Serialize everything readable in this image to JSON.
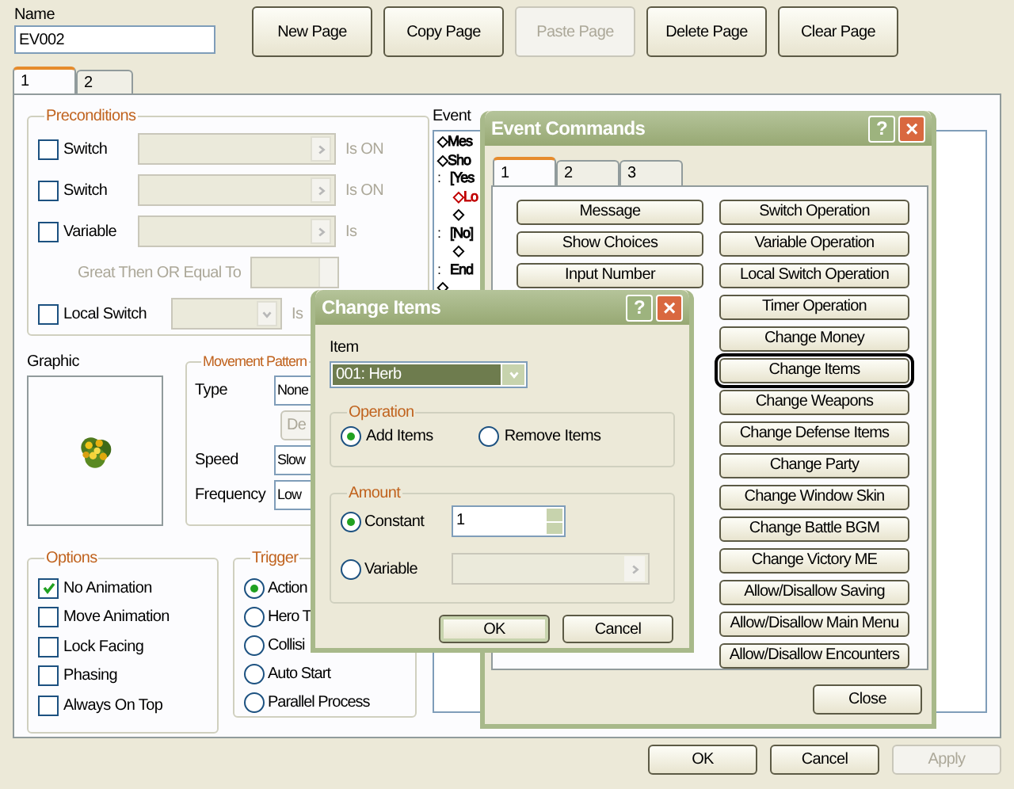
{
  "event_editor": {
    "name_label": "Name",
    "name_value": "EV002",
    "page_buttons": [
      {
        "label": "New Page",
        "disabled": false
      },
      {
        "label": "Copy Page",
        "disabled": false
      },
      {
        "label": "Paste Page",
        "disabled": true
      },
      {
        "label": "Delete Page",
        "disabled": false
      },
      {
        "label": "Clear Page",
        "disabled": false
      }
    ],
    "tabs": [
      {
        "label": "1",
        "selected": true
      },
      {
        "label": "2",
        "selected": false
      }
    ],
    "preconditions": {
      "title": "Preconditions",
      "rows": [
        {
          "kind": "select",
          "label": "Switch",
          "checked": false,
          "suffix": "Is ON"
        },
        {
          "kind": "select",
          "label": "Switch",
          "checked": false,
          "suffix": "Is ON"
        },
        {
          "kind": "select",
          "label": "Variable",
          "checked": false,
          "suffix": "Is"
        },
        {
          "kind": "number",
          "label": "Great Then OR Equal To"
        },
        {
          "kind": "local",
          "label": "Local Switch",
          "checked": false,
          "suffix": "Is"
        }
      ]
    },
    "graphic": {
      "label": "Graphic"
    },
    "movement": {
      "title": "Movement Pattern",
      "type_label": "Type",
      "type_value": "None",
      "button": "De",
      "speed_label": "Speed",
      "speed_value": "Slow",
      "frequency_label": "Frequency",
      "frequency_value": "Low"
    },
    "options": {
      "title": "Options",
      "items": [
        {
          "label": "No Animation",
          "checked": true
        },
        {
          "label": "Move Animation",
          "checked": false
        },
        {
          "label": "Lock Facing",
          "checked": false
        },
        {
          "label": "Phasing",
          "checked": false
        },
        {
          "label": "Always On Top",
          "checked": false
        }
      ]
    },
    "trigger": {
      "title": "Trigger",
      "items": [
        {
          "label": "Action",
          "selected": true
        },
        {
          "label": "Hero T",
          "selected": false
        },
        {
          "label": "Collisi",
          "selected": false
        },
        {
          "label": "Auto Start",
          "selected": false
        },
        {
          "label": "Parallel Process",
          "selected": false
        }
      ]
    },
    "event_list": {
      "label": "Event",
      "lines": [
        {
          "text": "◇Mes",
          "color": "#000000"
        },
        {
          "text": "◇Sho",
          "color": "#000000"
        },
        {
          "marker": ":",
          "text": "[Yes",
          "color": "#000000",
          "children": [
            {
              "text": "◇Lo",
              "color": "#c00000"
            },
            {
              "text": "◇",
              "color": "#000000"
            }
          ]
        },
        {
          "marker": ":",
          "text": "[No]",
          "color": "#000000",
          "children": [
            {
              "text": "◇",
              "color": "#000000"
            }
          ]
        },
        {
          "marker": ":",
          "text": "End",
          "color": "#000000"
        },
        {
          "text": "◇",
          "color": "#000000"
        }
      ]
    },
    "buttons": [
      {
        "label": "OK",
        "disabled": false
      },
      {
        "label": "Cancel",
        "disabled": false
      },
      {
        "label": "Apply",
        "disabled": true
      }
    ]
  },
  "event_commands": {
    "title": "Event Commands",
    "help": "?",
    "close_glyph": "×",
    "tabs": [
      {
        "label": "1",
        "selected": true
      },
      {
        "label": "2",
        "selected": false
      },
      {
        "label": "3",
        "selected": false
      }
    ],
    "left_buttons": [
      "Message",
      "Show Choices",
      "Input Number"
    ],
    "right_buttons": [
      {
        "label": "Switch Operation",
        "selected": false
      },
      {
        "label": "Variable Operation",
        "selected": false
      },
      {
        "label": "Local Switch Operation",
        "selected": false
      },
      {
        "label": "Timer Operation",
        "selected": false
      },
      {
        "label": "Change Money",
        "selected": false
      },
      {
        "label": "Change Items",
        "selected": true
      },
      {
        "label": "Change Weapons",
        "selected": false
      },
      {
        "label": "Change Defense Items",
        "selected": false
      },
      {
        "label": "Change Party",
        "selected": false
      },
      {
        "label": "Change Window Skin",
        "selected": false
      },
      {
        "label": "Change Battle BGM",
        "selected": false
      },
      {
        "label": "Change Victory ME",
        "selected": false
      },
      {
        "label": "Allow/Disallow Saving",
        "selected": false
      },
      {
        "label": "Allow/Disallow Main Menu",
        "selected": false
      },
      {
        "label": "Allow/Disallow Encounters",
        "selected": false
      }
    ],
    "close": "Close"
  },
  "change_items": {
    "title": "Change Items",
    "help": "?",
    "close_glyph": "×",
    "item_label": "Item",
    "item_value": "001: Herb",
    "operation": {
      "title": "Operation",
      "options": [
        {
          "label": "Add Items",
          "selected": true
        },
        {
          "label": "Remove Items",
          "selected": false
        }
      ]
    },
    "amount": {
      "title": "Amount",
      "options": [
        {
          "kind": "number",
          "label": "Constant",
          "selected": true,
          "value": "1"
        },
        {
          "kind": "select",
          "label": "Variable",
          "selected": false
        }
      ]
    },
    "buttons": [
      {
        "label": "OK",
        "default": true
      },
      {
        "label": "Cancel",
        "default": false
      }
    ]
  }
}
